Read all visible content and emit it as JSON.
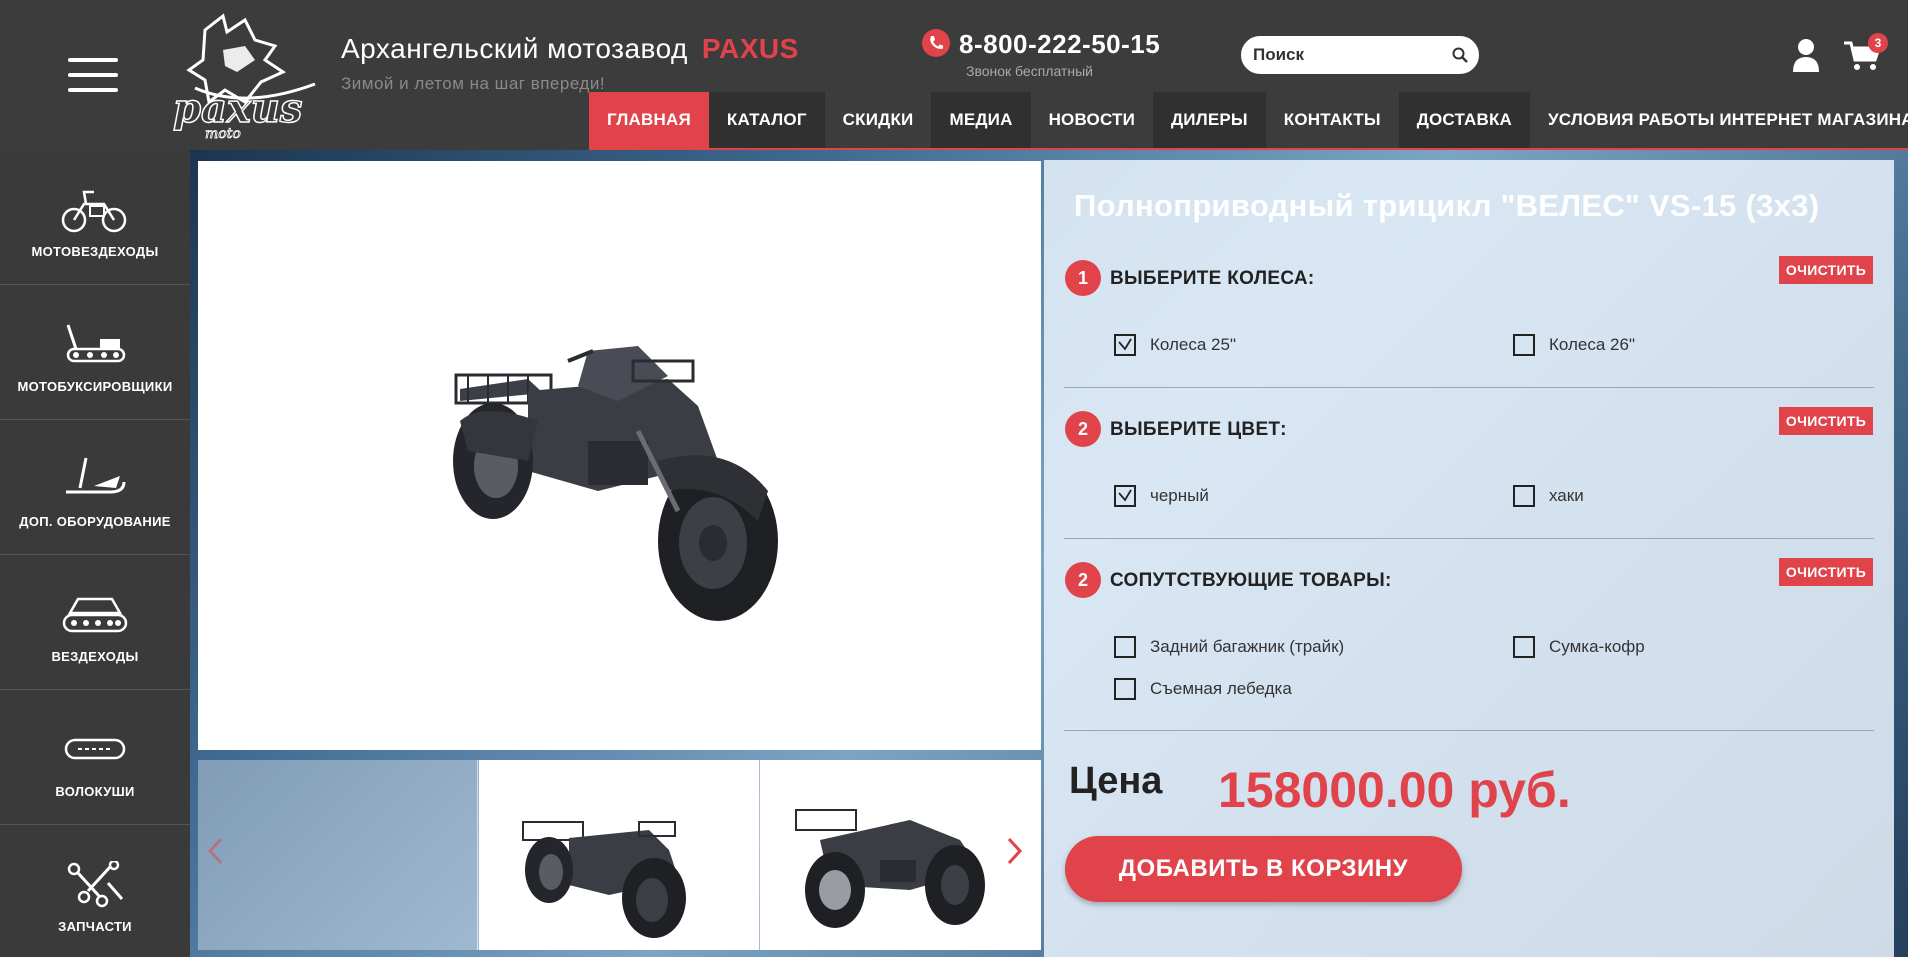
{
  "header": {
    "site_title": "Архангельский мотозавод",
    "brand": "PAXUS",
    "slogan": "Зимой и летом на шаг впереди!",
    "phone": "8-800-222-50-15",
    "phone_note": "Звонок бесплатный",
    "search_placeholder": "Поиск",
    "cart_count": "3",
    "logo_text": "paxus moto"
  },
  "nav": {
    "items": [
      {
        "label": "ГЛАВНАЯ"
      },
      {
        "label": "КАТАЛОГ"
      },
      {
        "label": "СКИДКИ"
      },
      {
        "label": "МЕДИА"
      },
      {
        "label": "НОВОСТИ"
      },
      {
        "label": "ДИЛЕРЫ"
      },
      {
        "label": "КОНТАКТЫ"
      },
      {
        "label": "ДОСТАВКА"
      },
      {
        "label": "УСЛОВИЯ РАБОТЫ ИНТЕРНЕТ МАГАЗИНА"
      }
    ]
  },
  "sidebar": {
    "items": [
      {
        "label": "МОТОВЕЗДЕХОДЫ",
        "icon": "atv-icon"
      },
      {
        "label": "МОТОБУКСИРОВЩИКИ",
        "icon": "snow-tractor-icon"
      },
      {
        "label": "ДОП. ОБОРУДОВАНИЕ",
        "icon": "sled-icon"
      },
      {
        "label": "ВЕЗДЕХОДЫ",
        "icon": "tracked-vehicle-icon"
      },
      {
        "label": "ВОЛОКУШИ",
        "icon": "drag-sled-icon"
      },
      {
        "label": "ЗАПЧАСТИ",
        "icon": "tools-icon"
      }
    ]
  },
  "product": {
    "title": "Полноприводный трицикл \"ВЕЛЕС\" VS-15 (3х3)",
    "clear_label": "ОЧИСТИТЬ",
    "steps": [
      {
        "num": "1",
        "title": "ВЫБЕРИТЕ КОЛЕСА:",
        "options": [
          {
            "label": "Колеса 25\"",
            "checked": true
          },
          {
            "label": "Колеса 26\"",
            "checked": false
          }
        ]
      },
      {
        "num": "2",
        "title": "ВЫБЕРИТЕ ЦВЕТ:",
        "options": [
          {
            "label": "черный",
            "checked": true
          },
          {
            "label": "хаки",
            "checked": false
          }
        ]
      },
      {
        "num": "2",
        "title": "СОПУТСТВУЮЩИЕ ТОВАРЫ:",
        "options": [
          {
            "label": "Задний багажник (трайк)",
            "checked": false
          },
          {
            "label": "Сумка-кофр",
            "checked": false
          },
          {
            "label": "Съемная лебедка",
            "checked": false
          }
        ]
      }
    ],
    "price_label": "Цена",
    "price": "158000.00 руб.",
    "add_to_cart": "ДОБАВИТЬ В КОРЗИНУ"
  },
  "colors": {
    "accent": "#e0434a",
    "header_bg": "#3c3c3c",
    "nav_alt_bg": "#303030"
  }
}
